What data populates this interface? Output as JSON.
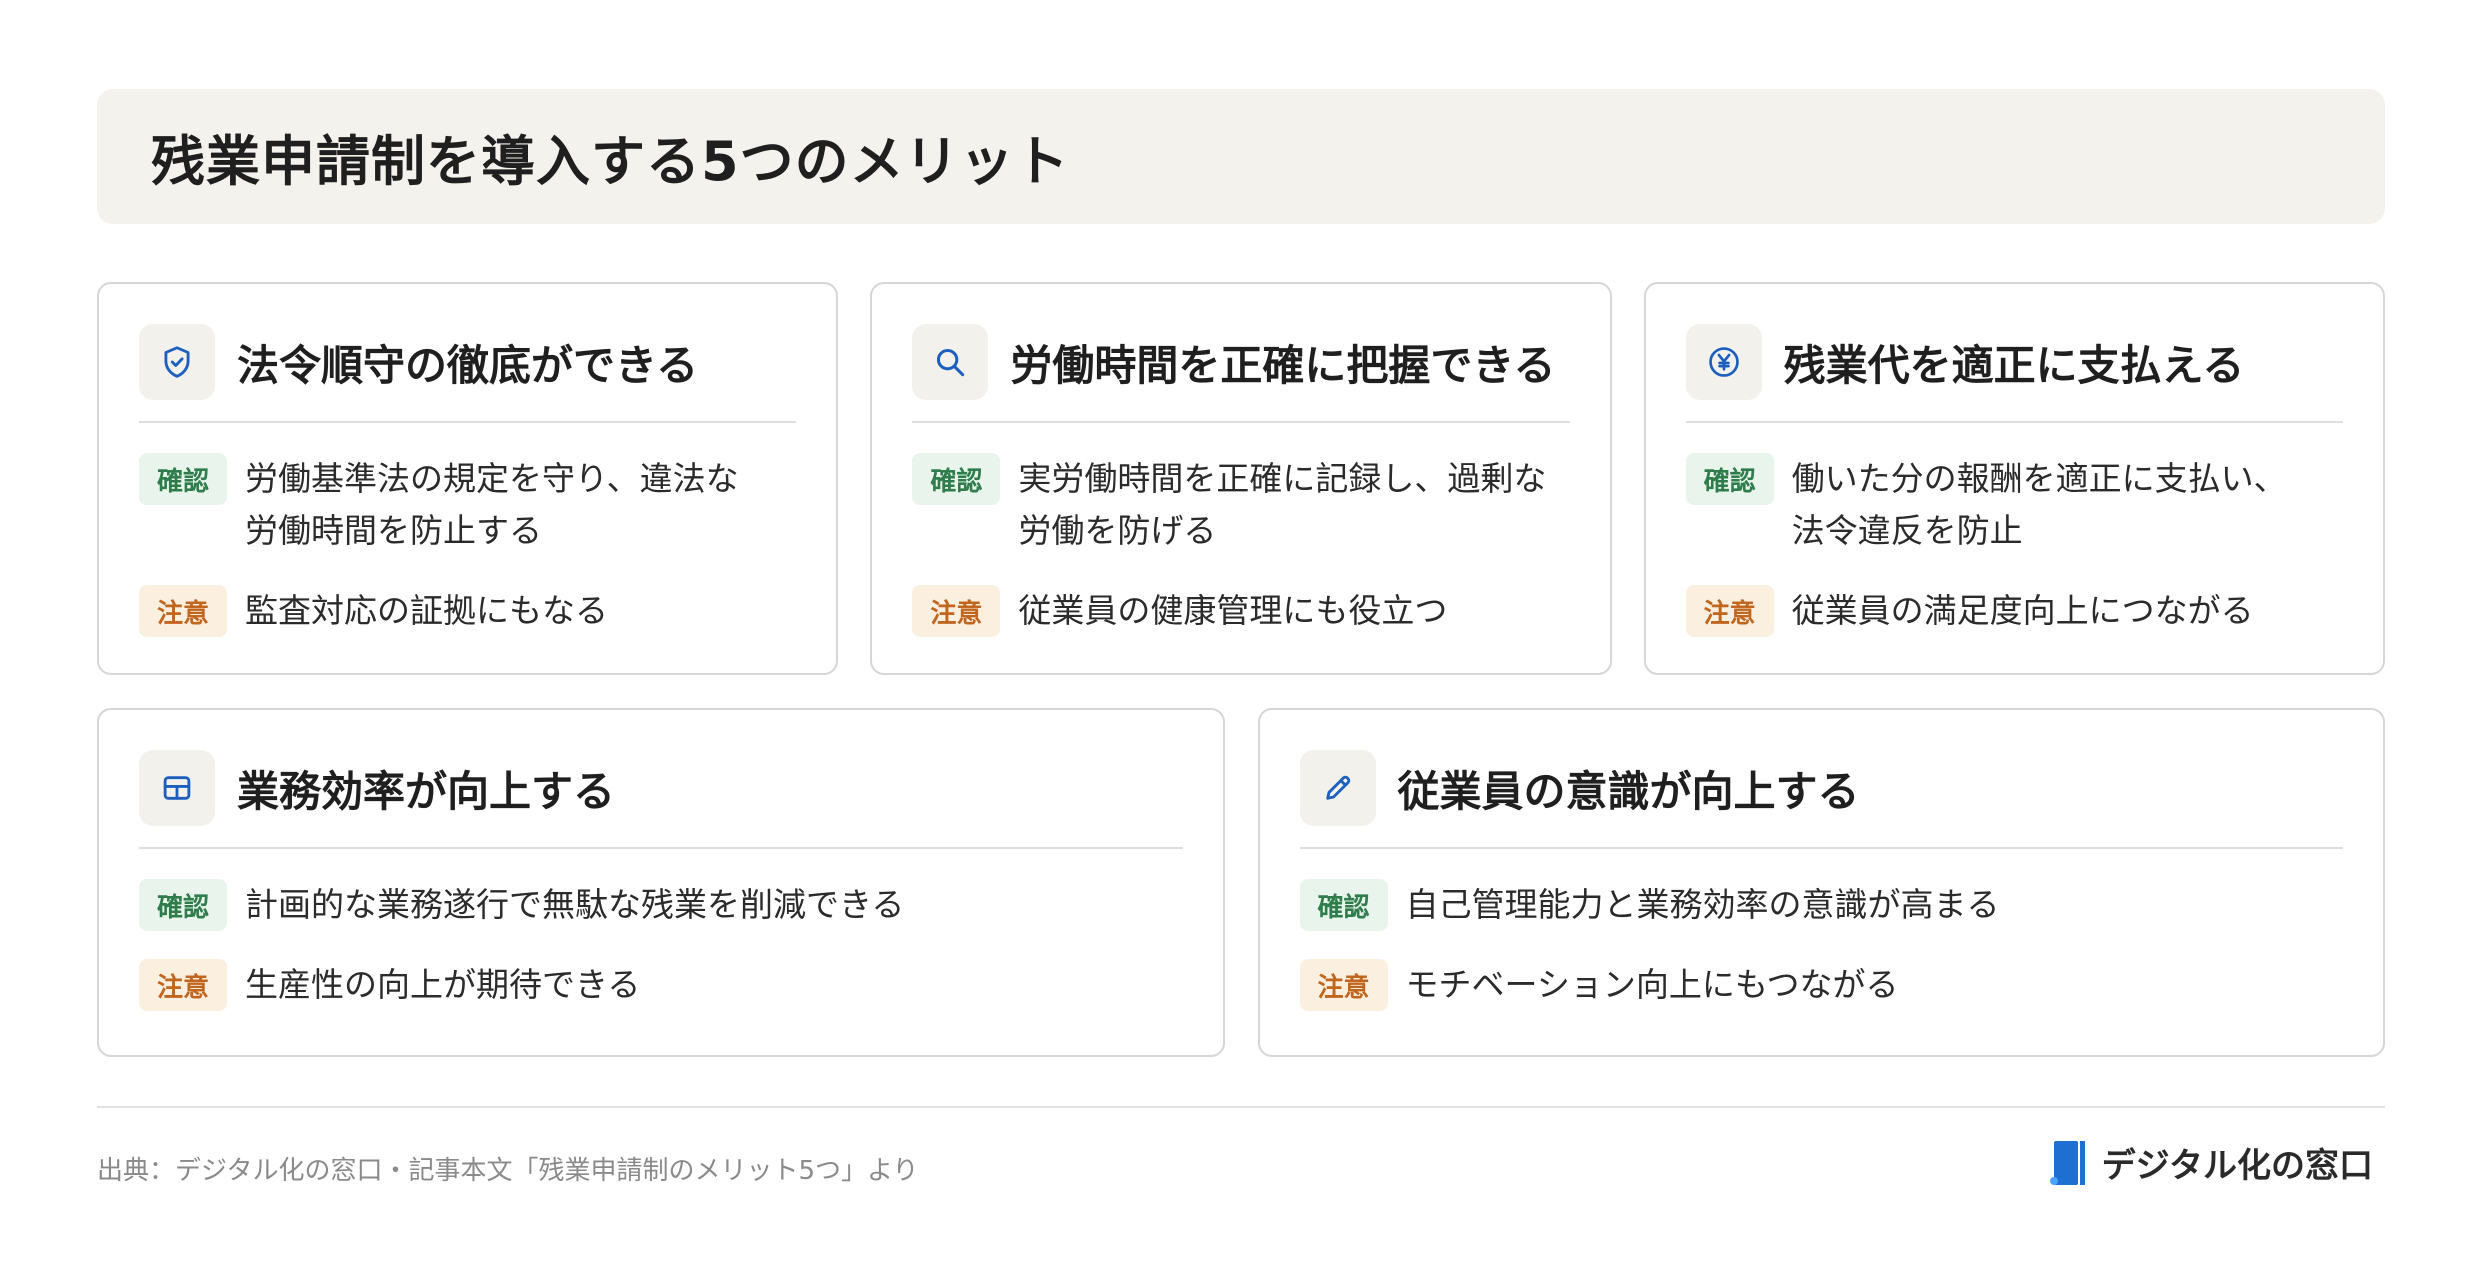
{
  "header": {
    "title": "残業申請制を導入する5つのメリット"
  },
  "badges": {
    "confirm": "確認",
    "caution": "注意"
  },
  "cards": [
    {
      "icon": "shield-check-icon",
      "title": "法令順守の徹底ができる",
      "confirm_text": "労働基準法の規定を守り、違法な\n労働時間を防止する",
      "caution_text": "監査対応の証拠にもなる"
    },
    {
      "icon": "search-icon",
      "title": "労働時間を正確に把握できる",
      "confirm_text": "実労働時間を正確に記録し、過剰な\n労働を防げる",
      "caution_text": "従業員の健康管理にも役立つ"
    },
    {
      "icon": "yen-circle-icon",
      "title": "残業代を適正に支払える",
      "confirm_text": "働いた分の報酬を適正に支払い、\n法令違反を防止",
      "caution_text": "従業員の満足度向上につながる"
    },
    {
      "icon": "layout-grid-icon",
      "title": "業務効率が向上する",
      "confirm_text": "計画的な業務遂行で無駄な残業を削減できる",
      "caution_text": "生産性の向上が期待できる"
    },
    {
      "icon": "pencil-icon",
      "title": "従業員の意識が向上する",
      "confirm_text": "自己管理能力と業務効率の意識が高まる",
      "caution_text": "モチベーション向上にもつながる"
    }
  ],
  "footer": {
    "source": "出典：デジタル化の窓口・記事本文「残業申請制のメリット5つ」より",
    "brand": "デジタル化の窓口"
  },
  "colors": {
    "icon_blue": "#1d5fbf",
    "confirm_bg": "#e8f4ec",
    "confirm_text": "#2f7d4b",
    "caution_bg": "#fbefdf",
    "caution_text": "#c0661f",
    "header_bg": "#f4f2ec",
    "brand_blue": "#1d6fd1"
  }
}
